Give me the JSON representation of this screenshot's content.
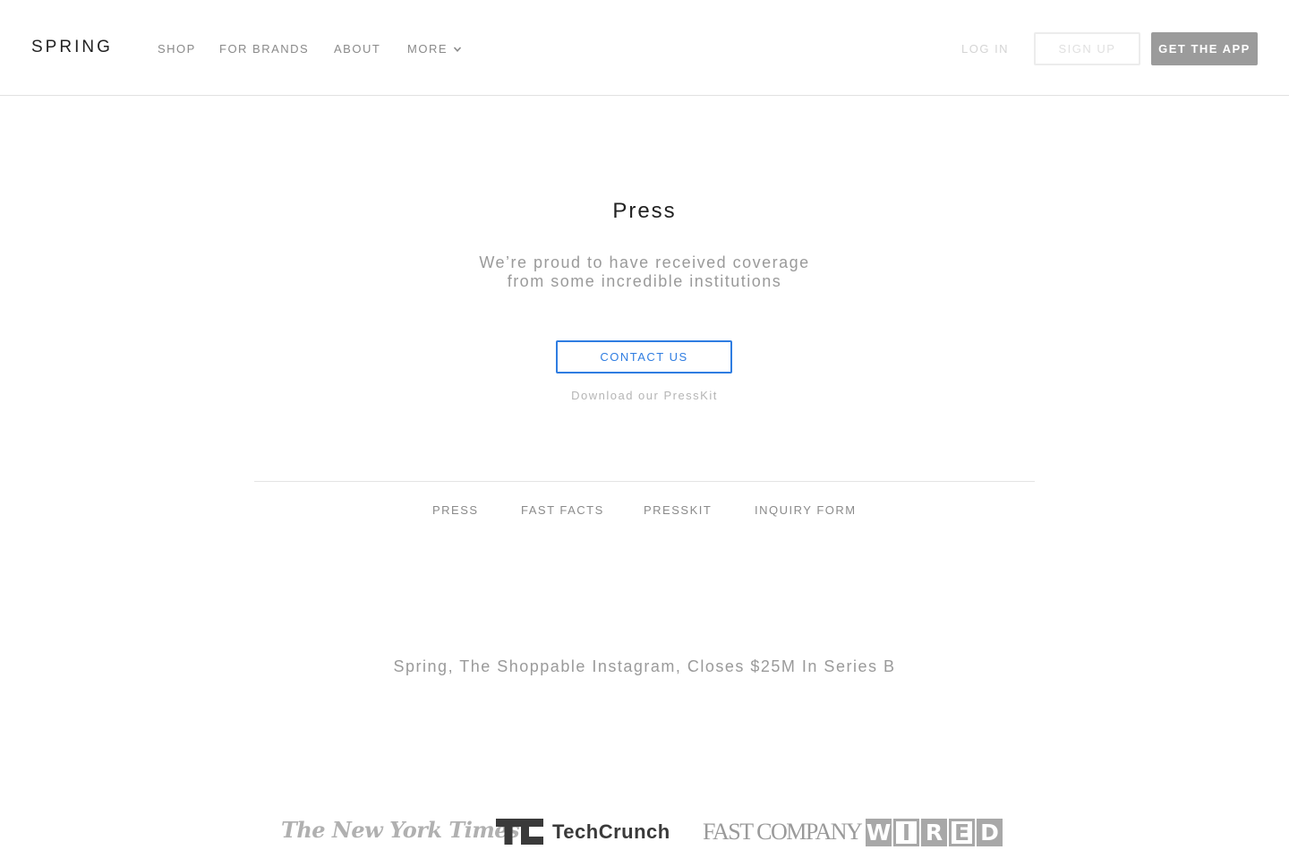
{
  "header": {
    "brand": "SPRING",
    "nav": [
      "SHOP",
      "FOR BRANDS",
      "ABOUT",
      "MORE"
    ],
    "login_label": "LOG IN",
    "signup_label": "SIGN UP",
    "get_app_label": "GET THE APP"
  },
  "hero": {
    "title": "Press",
    "subtitle_line1": "We’re proud to have received coverage",
    "subtitle_line2": "from some incredible institutions",
    "contact_label": "CONTACT US",
    "presskit_link": "Download our PressKit"
  },
  "subnav": [
    "PRESS",
    "FAST FACTS",
    "PRESSKIT",
    "INQUIRY FORM"
  ],
  "article": {
    "headline": "Spring, The Shoppable Instagram, Closes $25M In Series B"
  },
  "press_logos": {
    "nyt": "The New York Times",
    "techcrunch": "TechCrunch",
    "fastcompany": "FAST COMPANY",
    "wired": [
      "W",
      "I",
      "R",
      "E",
      "D"
    ]
  },
  "colors": {
    "accent": "#2f7de1",
    "get_app_bg": "#9b9b9b",
    "muted_text": "#9a9a9a"
  },
  "icons": {
    "more_dropdown": "chevron-down-icon",
    "techcrunch_mark": "techcrunch-logo-icon"
  }
}
